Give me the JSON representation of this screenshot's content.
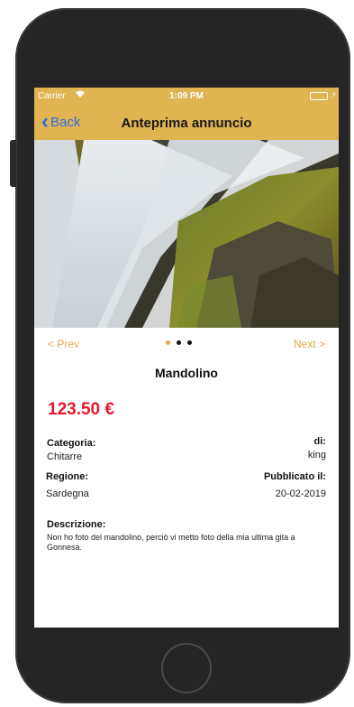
{
  "status_bar": {
    "carrier": "Carrier",
    "time": "1:09 PM",
    "battery_level": 1.0
  },
  "nav": {
    "back_label": "Back",
    "title": "Anteprima annuncio"
  },
  "gallery": {
    "prev_label": "< Prev",
    "next_label": "Next >",
    "page_count": 3,
    "current_page": 1
  },
  "listing": {
    "title": "Mandolino",
    "price": "123.50 €",
    "category_label": "Categoria:",
    "category_value": "Chitarre",
    "seller_label": "di:",
    "seller_value": "king",
    "region_label": "Regione:",
    "region_value": "Sardegna",
    "published_label": "Pubblicato il:",
    "published_value": "20-02-2019",
    "description_label": "Descrizione:",
    "description_text": "Non ho foto del mandolino, perciò vi metto foto della mia ultima gita a Gonnesa."
  },
  "colors": {
    "accent": "#e0b451",
    "price": "#e21a2f",
    "link": "#2f6fe0",
    "pager": "#e0a94a"
  }
}
